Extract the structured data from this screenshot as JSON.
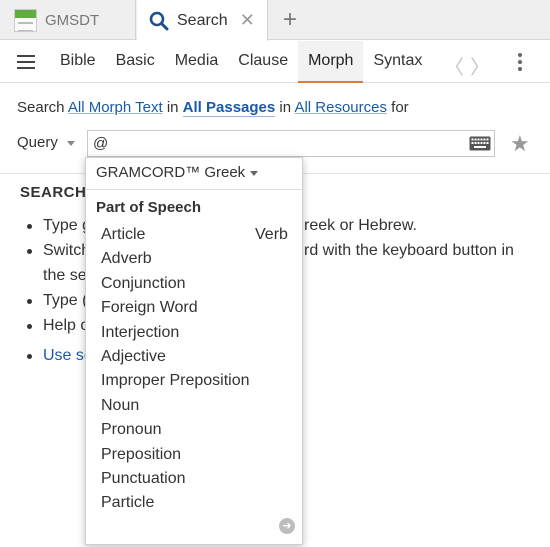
{
  "tabs": {
    "inactive_label": "GMSDT",
    "active_label": "Search",
    "close_glyph": "✕",
    "add_glyph": "+"
  },
  "toolbar": {
    "search_types": [
      "Bible",
      "Basic",
      "Media",
      "Clause",
      "Morph",
      "Syntax"
    ],
    "active_type": "Morph",
    "prev_glyph": "〈",
    "next_glyph": "〉"
  },
  "search_line": {
    "prefix": "Search",
    "scope_text": "All Morph Text",
    "in1": "in",
    "passages": "All Passages",
    "in2": "in",
    "resources": "All Resources",
    "suffix": "for"
  },
  "query": {
    "label": "Query",
    "value": "@"
  },
  "help": {
    "title": "SEARCH",
    "items": [
      "Type g",
      "Switch",
      "the se",
      "Type (",
      "Help o",
      "Use se"
    ],
    "visible_fragments": [
      "reek or Hebrew.",
      "rd with the keyboard button in"
    ]
  },
  "dropdown": {
    "morphology": "GRAMCORD™ Greek",
    "section_title": "Part of Speech",
    "items": [
      "Article",
      "Adverb",
      "Conjunction",
      "Foreign Word",
      "Interjection",
      "Adjective",
      "Improper Preposition",
      "Noun",
      "Pronoun",
      "Preposition",
      "Punctuation",
      "Particle"
    ],
    "side_item": "Verb"
  },
  "colors": {
    "link": "#1a5aa8",
    "active_tab_underline": "#e07b39",
    "thumb_green": "#5fae3f"
  }
}
